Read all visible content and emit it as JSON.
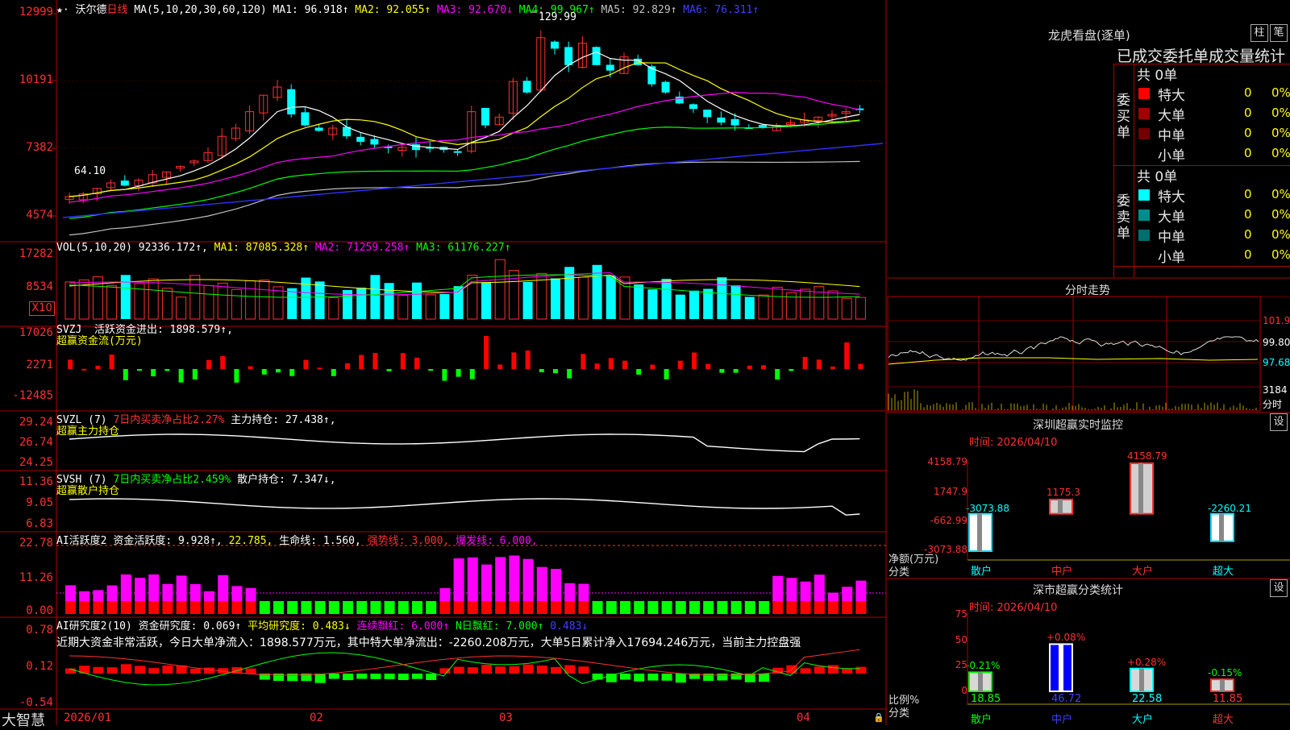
{
  "brand": "大智慧",
  "main_panel": {
    "legend": {
      "stock": "沃尔德",
      "period": "日线",
      "ma_params": "MA(5,10,20,30,60,120)",
      "ma": [
        {
          "name": "MA1:",
          "value": "96.918↑",
          "color": "#ffffff"
        },
        {
          "name": "MA2:",
          "value": "92.055↑",
          "color": "#ffff00"
        },
        {
          "name": "MA3:",
          "value": "92.670↓",
          "color": "#ff00ff"
        },
        {
          "name": "MA4:",
          "value": "99.967↑",
          "color": "#00ff00"
        },
        {
          "name": "MA5:",
          "value": "92.829↑",
          "color": "#c0c0c0"
        },
        {
          "name": "MA6:",
          "value": "76.311↑",
          "color": "#4040ff"
        }
      ]
    },
    "axis": [
      "12999",
      "10191",
      "7382",
      "4574"
    ],
    "high_label": "129.99",
    "low_label": "64.10"
  },
  "vol_panel": {
    "title": "VOL(5,10,20)",
    "value": "92336.172↑,",
    "ma": [
      {
        "name": "MA1:",
        "value": "87085.328↑",
        "color": "#ffff00"
      },
      {
        "name": "MA2:",
        "value": "71259.258↑",
        "color": "#ff00ff"
      },
      {
        "name": "MA3:",
        "value": "61176.227↑",
        "color": "#00ff00"
      }
    ],
    "axis": [
      "17282",
      "8534"
    ],
    "unit": "X10"
  },
  "svzj_panel": {
    "title": "SVZJ",
    "label": "活跃资金进出:",
    "value": "1898.579↑,",
    "sub": "超赢资金流(万元)",
    "axis": [
      "17026",
      "2271",
      "-12485"
    ]
  },
  "svzl_panel": {
    "title": "SVZL (7)",
    "label1": "7日内买卖净占比2.27%",
    "label2": "主力持仓:",
    "value": "27.438↑,",
    "sub": "超赢主力持仓",
    "axis": [
      "29.24",
      "26.74",
      "24.25"
    ]
  },
  "svsh_panel": {
    "title": "SVSH (7)",
    "label1": "7日内买卖净占比2.459%",
    "label2": "散户持仓:",
    "value": "7.347↓,",
    "sub": "超赢散户持仓",
    "axis": [
      "11.36",
      "9.05",
      "6.83"
    ]
  },
  "ai_active_panel": {
    "title": "AI活跃度2",
    "t1": "资金活跃度:",
    "v1": "9.928↑,",
    "v2": "22.785,",
    "t3": "生命线:",
    "v3": "1.560,",
    "t4": "强势线:",
    "v4": "3.000,",
    "t5": "爆发线:",
    "v5": "6.000,",
    "axis": [
      "22.78",
      "11.26",
      "0.00"
    ]
  },
  "ai_research_panel": {
    "title": "AI研究度2(10)",
    "t1": "资金研究度:",
    "v1": "0.069↑",
    "t2": "平均研究度:",
    "v2": "0.483↓",
    "t3": "连续飘红:",
    "v3": "6.000↑",
    "t4": "N日飘红:",
    "v4": "7.000↑",
    "v5": "0.483↓",
    "summary": "近期大资金非常活跃，今日大单净流入：1898.577万元，其中特大单净流出：-2260.208万元，大单5日累计净入17694.246万元，当前主力控盘强",
    "axis": [
      "0.78",
      "0.12",
      "-0.54"
    ]
  },
  "date_axis": [
    "2026/01",
    "02",
    "03",
    "04"
  ],
  "longhu": {
    "title": "龙虎看盘(逐单)",
    "btn1": "柱",
    "btn2": "笔",
    "subtitle": "已成交委托单成交量统计",
    "buy": {
      "side": "委买单",
      "total": "共 0单",
      "rows": [
        {
          "label": "特大",
          "color": "#ff0000",
          "num": "0",
          "pct": "0%"
        },
        {
          "label": "大单",
          "color": "#a00000",
          "num": "0",
          "pct": "0%"
        },
        {
          "label": "中单",
          "color": "#700000",
          "num": "0",
          "pct": "0%"
        },
        {
          "label": "小单",
          "color": "",
          "num": "0",
          "pct": "0%"
        }
      ]
    },
    "sell": {
      "side": "委卖单",
      "total": "共 0单",
      "rows": [
        {
          "label": "特大",
          "color": "#00ffff",
          "num": "0",
          "pct": "0%"
        },
        {
          "label": "大单",
          "color": "#008c8c",
          "num": "0",
          "pct": "0%"
        },
        {
          "label": "中单",
          "color": "#006e6e",
          "num": "0",
          "pct": "0%"
        },
        {
          "label": "小单",
          "color": "",
          "num": "0",
          "pct": "0%"
        }
      ]
    }
  },
  "intraday": {
    "title": "分时走势",
    "axis": [
      "101.9",
      "99.80",
      "97.68",
      "3184"
    ],
    "vol_label": "分时"
  },
  "sz_monitor": {
    "title": "深圳超赢实时监控",
    "set_btn": "设",
    "time": "时间: 2026/04/10",
    "axis": [
      "4158.79",
      "1747.9",
      "-662.99",
      "-3073.88"
    ],
    "ylabel": "净额(万元)",
    "xlabel": "分类",
    "bars": [
      {
        "cat": "散户",
        "value": "-3073.88",
        "num": -3073.88
      },
      {
        "cat": "中户",
        "value": "1175.3",
        "num": 1175.3
      },
      {
        "cat": "大户",
        "value": "4158.79",
        "num": 4158.79
      },
      {
        "cat": "超大",
        "value": "-2260.21",
        "num": -2260.21
      }
    ]
  },
  "sz_class": {
    "title": "深市超赢分类统计",
    "set_btn": "设",
    "time": "时间: 2026/04/10",
    "axis": [
      "75",
      "50",
      "25",
      "0"
    ],
    "ylabel": "比例%",
    "xlabel": "分类",
    "bars": [
      {
        "cat": "散户",
        "value": "18.85",
        "delta": "-0.21%",
        "num": 18.85
      },
      {
        "cat": "中户",
        "value": "46.72",
        "delta": "+0.08%",
        "num": 46.72
      },
      {
        "cat": "大户",
        "value": "22.58",
        "delta": "+0.28%",
        "num": 22.58
      },
      {
        "cat": "超大",
        "value": "11.85",
        "delta": "-0.15%",
        "num": 11.85
      }
    ]
  }
}
